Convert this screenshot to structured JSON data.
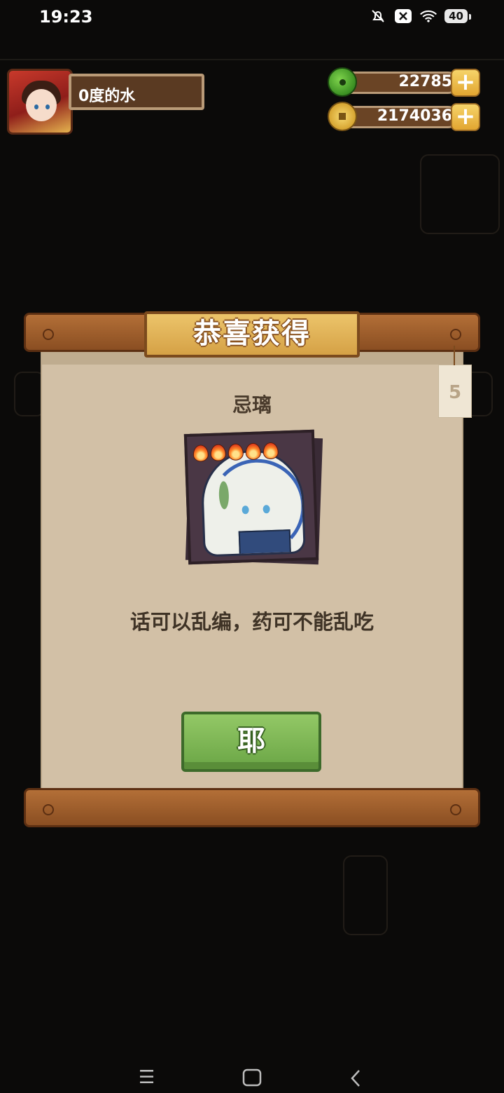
{
  "status_bar": {
    "time": "19:23",
    "battery": "40"
  },
  "player": {
    "name": "0度的水"
  },
  "resources": [
    {
      "icon": "jade-icon",
      "value": "22785",
      "plus": "+"
    },
    {
      "icon": "coin-icon",
      "value": "2174036",
      "plus": "+"
    }
  ],
  "dialog": {
    "title": "恭喜获得",
    "character_name": "忌璃",
    "star_count": 5,
    "quote": "话可以乱编，药可不能乱吃",
    "confirm_label": "耶",
    "tag_glyph": "5"
  },
  "nav": {
    "menu": "☰",
    "home": "▢",
    "back": "‹"
  },
  "colors": {
    "paper": "#d2c0a6",
    "wood": "#a05f2e",
    "gold": "#e3b353",
    "green": "#7cb651",
    "background": "#0b0a09"
  }
}
